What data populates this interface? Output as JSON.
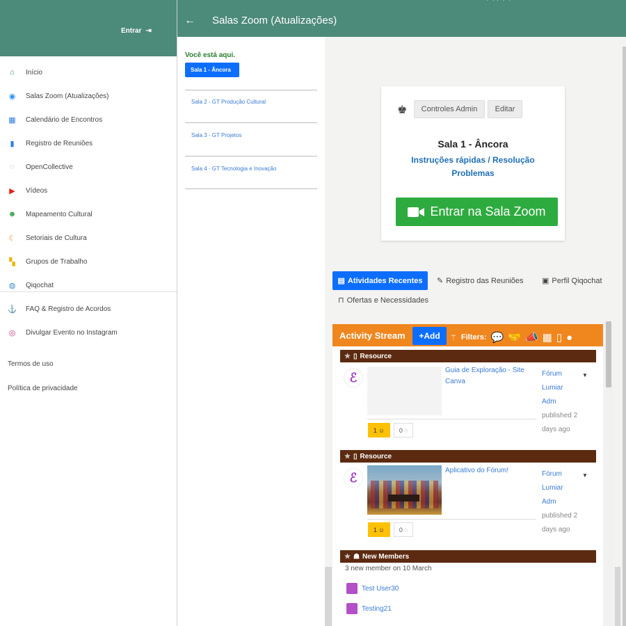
{
  "header": {
    "title": "Salas Zoom (Atualizações)",
    "login_label": "Entrar"
  },
  "sidebar": {
    "items": [
      {
        "label": "Início",
        "icon": "home-icon",
        "color": "#3a8a5c"
      },
      {
        "label": "Salas Zoom (Atualizações)",
        "icon": "zoom-icon",
        "color": "#2d8cff"
      },
      {
        "label": "Calendário de Encontros",
        "icon": "calendar-icon",
        "color": "#2f7de1"
      },
      {
        "label": "Registro de Reuniões",
        "icon": "document-icon",
        "color": "#2f7de1"
      },
      {
        "label": "OpenCollective",
        "icon": "opencollective-icon",
        "color": "#7fadf2"
      },
      {
        "label": "Vídeos",
        "icon": "youtube-icon",
        "color": "#e62117"
      },
      {
        "label": "Mapeamento Cultural",
        "icon": "people-icon",
        "color": "#3aa14b"
      },
      {
        "label": "Setoriais de Cultura",
        "icon": "setoriais-icon",
        "color": "#f0861e"
      },
      {
        "label": "Grupos de Trabalho",
        "icon": "groups-icon",
        "color": "#f0b400"
      },
      {
        "label": "Qiqochat",
        "icon": "globe-icon",
        "color": "#3a8ac8"
      },
      {
        "label": "FAQ & Registro de Acordos",
        "icon": "anchor-icon",
        "color": "#3aa14b"
      },
      {
        "label": "Divulgar Evento no Instagram",
        "icon": "instagram-icon",
        "color": "#c13584"
      }
    ],
    "footer": [
      "Termos de uso",
      "Política de privacidade"
    ]
  },
  "rooms": {
    "here_label": "Você está aqui.",
    "active": "Sala 1 - Âncora",
    "others": [
      "Sala 2 - GT Produção Cultural",
      "Sala 3 - GT Projetos",
      "Sala 4 - GT Tecnologia e Inovação"
    ]
  },
  "room_card": {
    "admin_controls": "Controles Admin",
    "edit": "Editar",
    "title": "Sala 1 - Âncora",
    "instructions": "Instruções rápidas / Resolução Problemas",
    "join_button": "Entrar na Sala Zoom"
  },
  "tabs": {
    "recent": "Atividades Recentes",
    "meetings": "Registro das Reuniões",
    "profile": "Perfil Qiqochat",
    "offers": "Ofertas e Necessidades"
  },
  "stream": {
    "title": "Activity Stream",
    "add": "Add",
    "filters": "Filters:",
    "resources": [
      {
        "section": "Resource",
        "title": "Guia de Exploração - Site Canva",
        "author": [
          "Fórum",
          "Lumiar",
          "Adm"
        ],
        "published": "published 2 days ago",
        "likes": "1",
        "comments": "0"
      },
      {
        "section": "Resource",
        "title": "Aplicativo do Fórum!",
        "author": [
          "Fórum",
          "Lumiar",
          "Adm"
        ],
        "published": "published 2 days ago",
        "likes": "1",
        "comments": "0"
      }
    ],
    "new_members": {
      "section": "New Members",
      "text": "3 new member on 10 March",
      "members": [
        "Test User30",
        "Testing21"
      ]
    }
  },
  "colors": {
    "header": "#4c8a79",
    "primary": "#0d6efd",
    "zoom_green": "#2eab3f",
    "stream_orange": "#f0861e",
    "section_brown": "#5c2a10"
  }
}
